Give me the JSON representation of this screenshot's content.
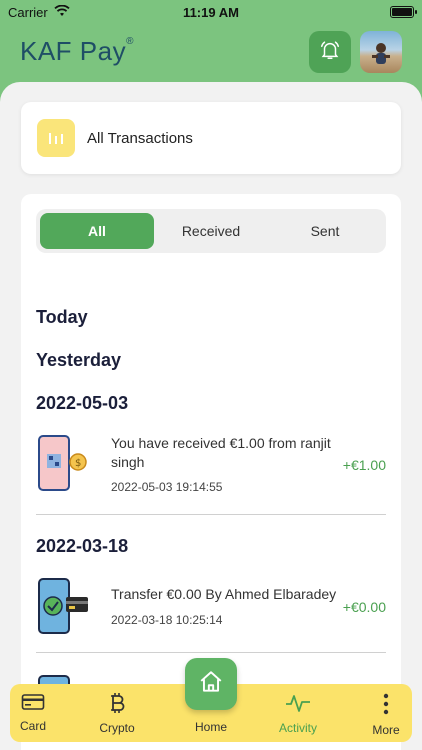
{
  "status": {
    "carrier": "Carrier",
    "time": "11:19 AM"
  },
  "header": {
    "logo": "KAF Pay",
    "logo_mark": "®"
  },
  "summary_card": {
    "label": "All Transactions"
  },
  "tabs": [
    {
      "label": "All",
      "active": true
    },
    {
      "label": "Received",
      "active": false
    },
    {
      "label": "Sent",
      "active": false
    }
  ],
  "sections": {
    "today": "Today",
    "yesterday": "Yesterday",
    "d1": "2022-05-03",
    "d2": "2022-03-18"
  },
  "transactions": [
    {
      "description": "You have received €1.00 from ranjit singh",
      "datetime": "2022-05-03 19:14:55",
      "amount": "+€1.00"
    },
    {
      "description": "Transfer €0.00 By Ahmed Elbaradey",
      "datetime": "2022-03-18 10:25:14",
      "amount": "+€0.00"
    }
  ],
  "nav": {
    "card": "Card",
    "crypto": "Crypto",
    "home": "Home",
    "activity": "Activity",
    "more": "More"
  },
  "colors": {
    "green": "#7cc47f",
    "accent": "#52a85a",
    "yellow": "#fbe36a"
  }
}
